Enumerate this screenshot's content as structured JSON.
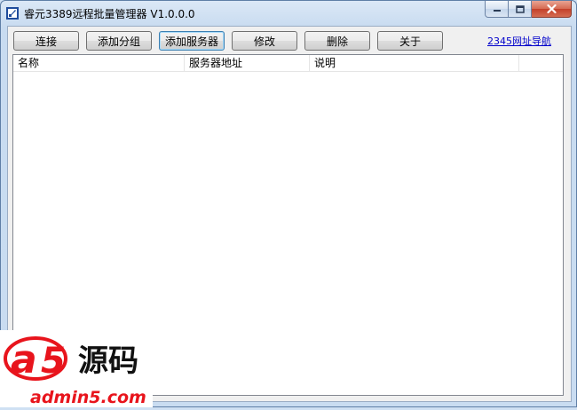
{
  "window": {
    "title": "睿元3389远程批量管理器 V1.0.0.0"
  },
  "toolbar": {
    "buttons": [
      {
        "label": "连接"
      },
      {
        "label": "添加分组"
      },
      {
        "label": "添加服务器"
      },
      {
        "label": "修改"
      },
      {
        "label": "删除"
      },
      {
        "label": "关于"
      }
    ],
    "nav_link": "2345网址导航"
  },
  "list": {
    "columns": [
      "名称",
      "服务器地址",
      "说明"
    ]
  },
  "watermark": {
    "brand_a": "a",
    "brand_5": "5",
    "brand_cn": "源码",
    "site": "admin5.com"
  },
  "colors": {
    "accent_red": "#e8141c",
    "link_blue": "#0000cc"
  },
  "icons": [
    "app-icon",
    "minimize-icon",
    "maximize-icon",
    "close-icon"
  ]
}
